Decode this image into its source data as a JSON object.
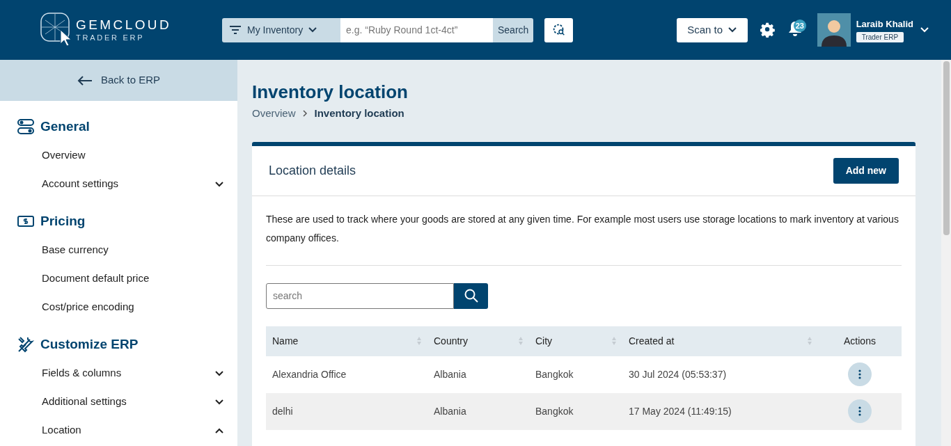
{
  "header": {
    "logo_title": "GEMCLOUD",
    "logo_subtitle": "TRADER ERP",
    "search_scope": "My Inventory",
    "search_placeholder": "e.g. “Ruby Round 1ct-4ct”",
    "search_button": "Search",
    "scan_button": "Scan to",
    "notification_count": "23",
    "user_name": "Laraib Khalid",
    "user_role": "Trader ERP"
  },
  "sidebar": {
    "back_label": "Back to ERP",
    "sections": [
      {
        "title": "General",
        "items": [
          {
            "label": "Overview",
            "kind": "link"
          },
          {
            "label": "Account settings",
            "kind": "submenu",
            "expanded": false
          }
        ]
      },
      {
        "title": "Pricing",
        "items": [
          {
            "label": "Base currency",
            "kind": "link"
          },
          {
            "label": "Document default price",
            "kind": "link"
          },
          {
            "label": "Cost/price encoding",
            "kind": "link"
          }
        ]
      },
      {
        "title": "Customize ERP",
        "items": [
          {
            "label": "Fields & columns",
            "kind": "submenu",
            "expanded": false
          },
          {
            "label": "Additional settings",
            "kind": "submenu",
            "expanded": false
          },
          {
            "label": "Location",
            "kind": "submenu",
            "expanded": true
          }
        ]
      }
    ]
  },
  "page": {
    "title": "Inventory location",
    "breadcrumbs": [
      "Overview",
      "Inventory location"
    ]
  },
  "card": {
    "title": "Location details",
    "add_button": "Add new",
    "description": "These are used to track where your goods are stored at any given time. For example most users use storage locations to mark inventory at various company offices.",
    "search_placeholder": "search"
  },
  "table": {
    "columns": [
      {
        "label": "Name",
        "sortable": true
      },
      {
        "label": "Country",
        "sortable": true
      },
      {
        "label": "City",
        "sortable": true
      },
      {
        "label": "Created at",
        "sortable": true
      },
      {
        "label": "Actions",
        "sortable": false
      }
    ],
    "rows": [
      {
        "cells": [
          "Alexandria Office",
          "Albania",
          "Bangkok",
          "30 Jul 2024 (05:53:37)"
        ]
      },
      {
        "cells": [
          "delhi",
          "Albania",
          "Bangkok",
          "17 May 2024 (11:49:15)"
        ]
      }
    ]
  }
}
